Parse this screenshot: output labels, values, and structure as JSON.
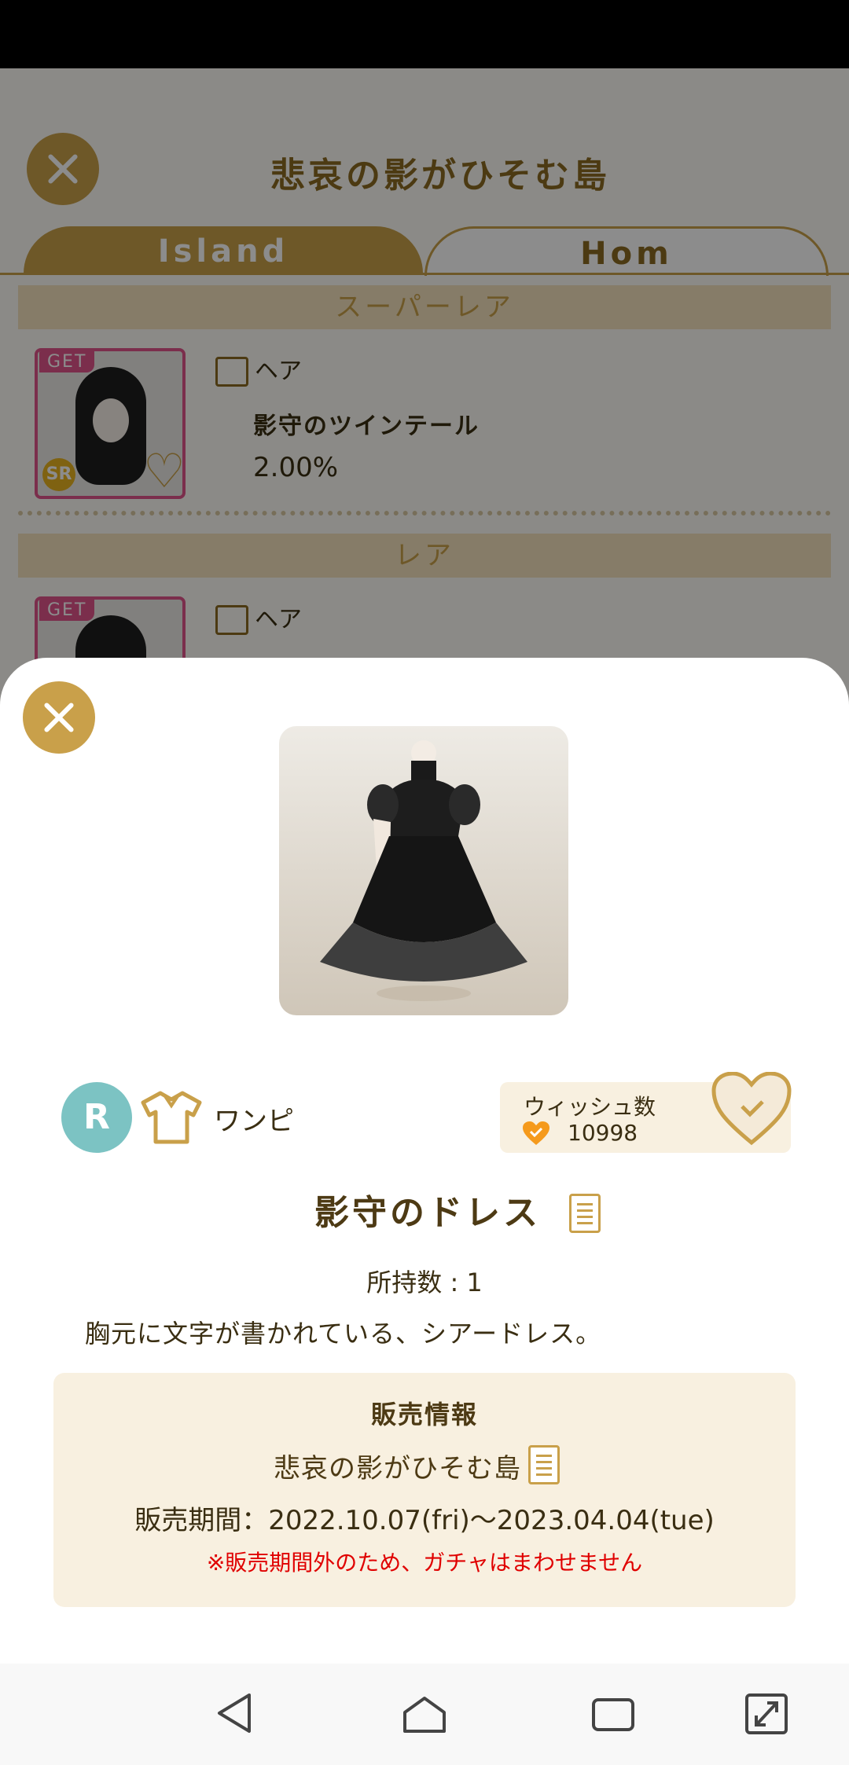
{
  "background": {
    "title": "悲哀の影がひそむ島",
    "tabs": [
      {
        "label": "Island"
      },
      {
        "label": "Hom"
      }
    ],
    "sections": [
      {
        "label": "スーパーレア"
      },
      {
        "label": "レア"
      }
    ],
    "items": [
      {
        "badge": "GET",
        "rarity": "SR",
        "category": "ヘア",
        "name": "影守のツインテール",
        "rate": "2.00%"
      },
      {
        "badge": "GET",
        "category": "ヘア"
      }
    ]
  },
  "detail": {
    "rarity": "R",
    "category_icon": "dress-shirt-icon",
    "category": "ワンピ",
    "wish": {
      "label": "ウィッシュ数",
      "count": "10998"
    },
    "item_name": "影守のドレス",
    "owned_label": "所持数",
    "owned_value": "1",
    "description": "胸元に文字が書かれている、シアードレス。",
    "sales": {
      "title": "販売情報",
      "island": "悲哀の影がひそむ島",
      "period": "販売期間：2022.10.07(fri)〜2023.04.04(tue)",
      "note": "※販売期間外のため、ガチャはまわせません"
    }
  },
  "colors": {
    "accent": "#c9a04a",
    "text": "#3a2e12",
    "warning": "#e00000",
    "rarity_r": "#7cc3c3"
  }
}
